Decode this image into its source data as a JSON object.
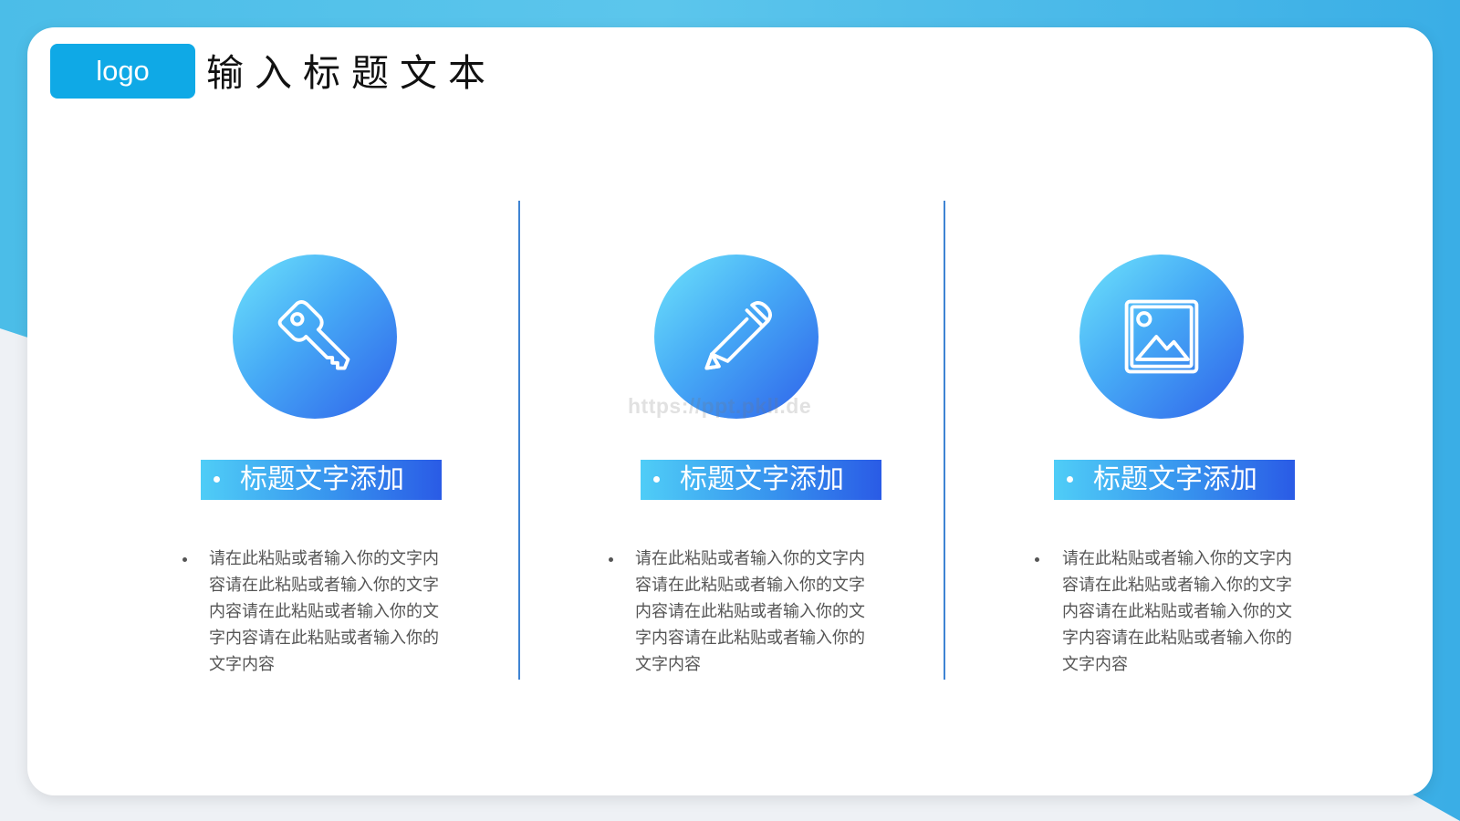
{
  "header": {
    "logo_text": "logo",
    "title": "输入标题文本"
  },
  "columns": [
    {
      "icon": "key-icon",
      "tag_label": "标题文字添加",
      "body": "请在此粘贴或者输入你的文字内容请在此粘贴或者输入你的文字内容请在此粘贴或者输入你的文字内容请在此粘贴或者输入你的文字内容"
    },
    {
      "icon": "pencil-icon",
      "tag_label": "标题文字添加",
      "body": "请在此粘贴或者输入你的文字内容请在此粘贴或者输入你的文字内容请在此粘贴或者输入你的文字内容请在此粘贴或者输入你的文字内容"
    },
    {
      "icon": "image-icon",
      "tag_label": "标题文字添加",
      "body": "请在此粘贴或者输入你的文字内容请在此粘贴或者输入你的文字内容请在此粘贴或者输入你的文字内容请在此粘贴或者输入你的文字内容"
    }
  ],
  "watermark": "https://ppt.pkll.de",
  "colors": {
    "accent": "#0fa9e6",
    "divider": "#3f84d3",
    "gradient_start": "#6ee3fb",
    "gradient_end": "#2f62ea"
  }
}
